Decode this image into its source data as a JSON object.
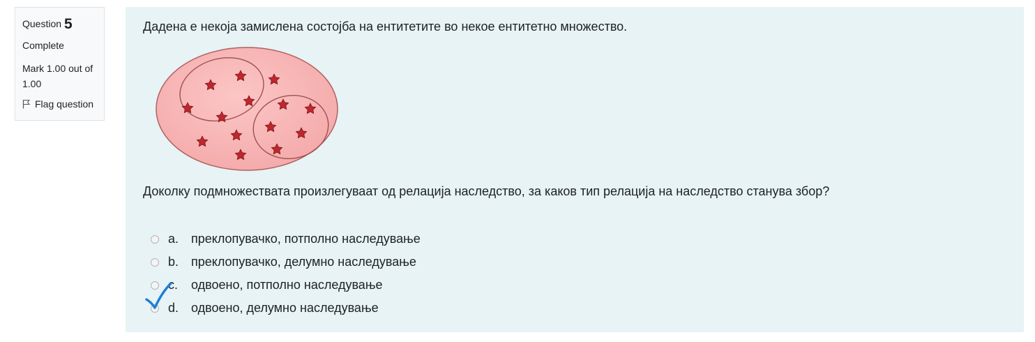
{
  "info": {
    "question_label": "Question",
    "question_number": "5",
    "state": "Complete",
    "grade": "Mark 1.00 out of 1.00",
    "flag_label": "Flag question"
  },
  "question": {
    "text": "Дадена е некоја замислена состојба на ентитетите во некое ентитетно множество.",
    "prompt": "Доколку подмножествата произлегуваат од релација наследство, за каков тип релација на наследство станува збор?"
  },
  "answers": [
    {
      "letter": "a.",
      "text": "преклопувачко, потполно наследување"
    },
    {
      "letter": "b.",
      "text": "преклопувачко, делумно наследување"
    },
    {
      "letter": "c.",
      "text": "одвоено, потполно наследување"
    },
    {
      "letter": "d.",
      "text": "одвоено, делумно наследување"
    }
  ],
  "colors": {
    "set_fill": "#f9b9b9",
    "star": "#c0272d",
    "check": "#1f7ed6"
  },
  "icons": {
    "flag": "flag-icon",
    "check": "checkmark-icon"
  }
}
